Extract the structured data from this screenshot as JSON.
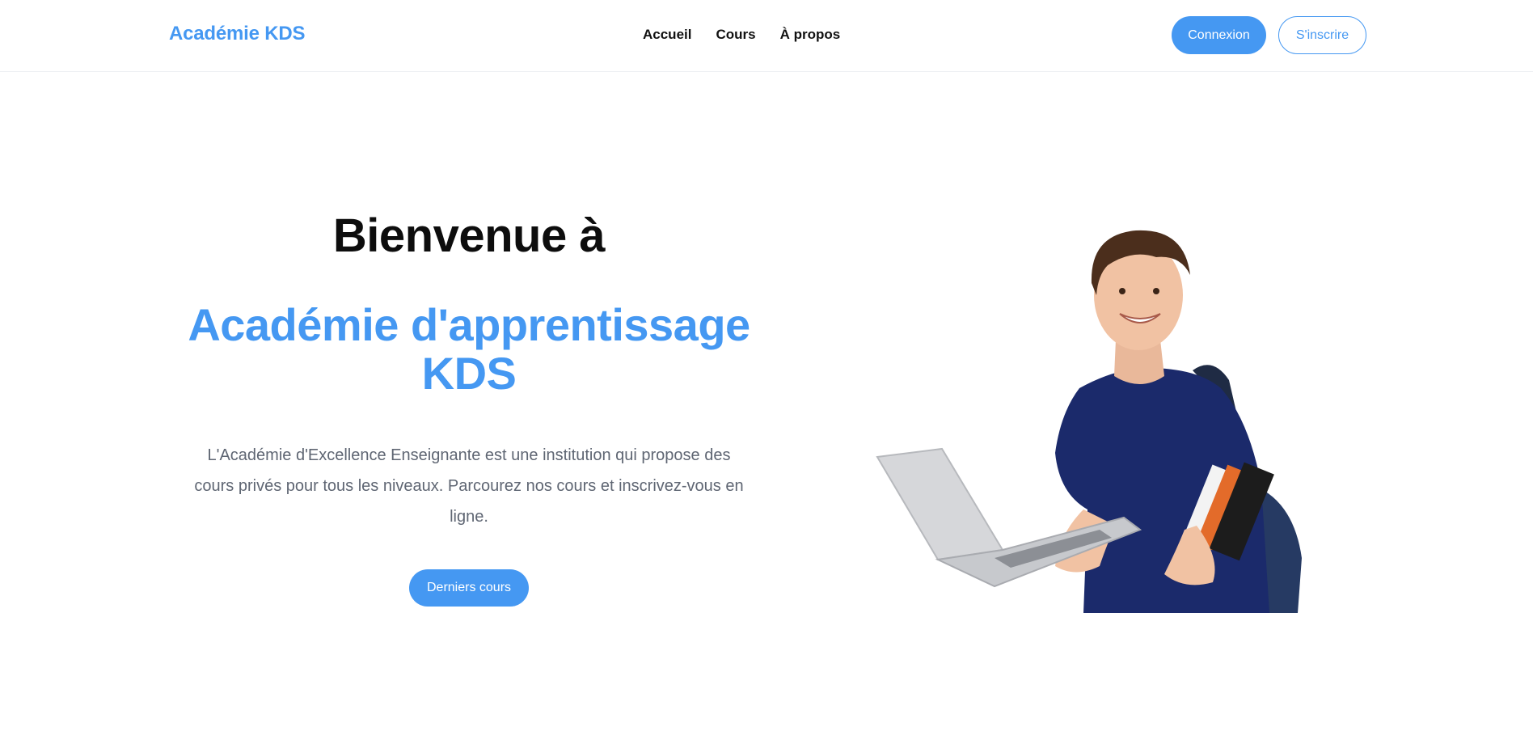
{
  "nav": {
    "brand": "Académie KDS",
    "links": [
      "Accueil",
      "Cours",
      "À propos"
    ],
    "login_label": "Connexion",
    "signup_label": "S'inscrire"
  },
  "hero": {
    "title": "Bienvenue à",
    "subtitle": "Académie d'apprentissage KDS",
    "description": "L'Académie d'Excellence Enseignante est une institution qui propose des cours privés pour tous les niveaux. Parcourez nos cours et inscrivez-vous en ligne.",
    "cta_label": "Derniers cours",
    "image_icon": "student-with-laptop-illustration"
  },
  "colors": {
    "accent": "#4598f2",
    "text_dark": "#111111",
    "text_muted": "#5f6673",
    "shirt": "#1b2a6b"
  }
}
